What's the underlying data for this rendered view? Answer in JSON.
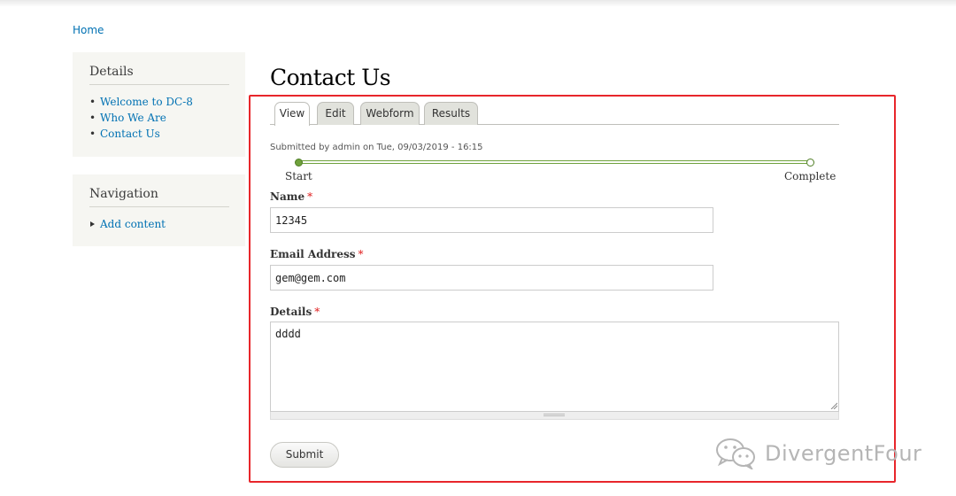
{
  "breadcrumb": {
    "home": "Home"
  },
  "sidebar": {
    "details": {
      "title": "Details",
      "items": [
        {
          "label": "Welcome to DC-8"
        },
        {
          "label": "Who We Are"
        },
        {
          "label": "Contact Us"
        }
      ]
    },
    "navigation": {
      "title": "Navigation",
      "items": [
        {
          "label": "Add content"
        }
      ]
    }
  },
  "page": {
    "title": "Contact Us"
  },
  "tabs": [
    {
      "label": "View",
      "active": true
    },
    {
      "label": "Edit",
      "active": false
    },
    {
      "label": "Webform",
      "active": false
    },
    {
      "label": "Results",
      "active": false
    }
  ],
  "submitted": "Submitted by admin on Tue, 09/03/2019 - 16:15",
  "progress": {
    "start_label": "Start",
    "end_label": "Complete"
  },
  "form": {
    "required_marker": "*",
    "name": {
      "label": "Name",
      "value": "12345"
    },
    "email": {
      "label": "Email Address",
      "value": "gem@gem.com"
    },
    "details": {
      "label": "Details",
      "value": "dddd"
    },
    "submit_label": "Submit"
  },
  "watermark": {
    "text": "DivergentFour"
  },
  "colors": {
    "link": "#0071b3",
    "highlight_border": "#e8262b",
    "progress_green": "#6fa13c",
    "required": "#e02020"
  }
}
